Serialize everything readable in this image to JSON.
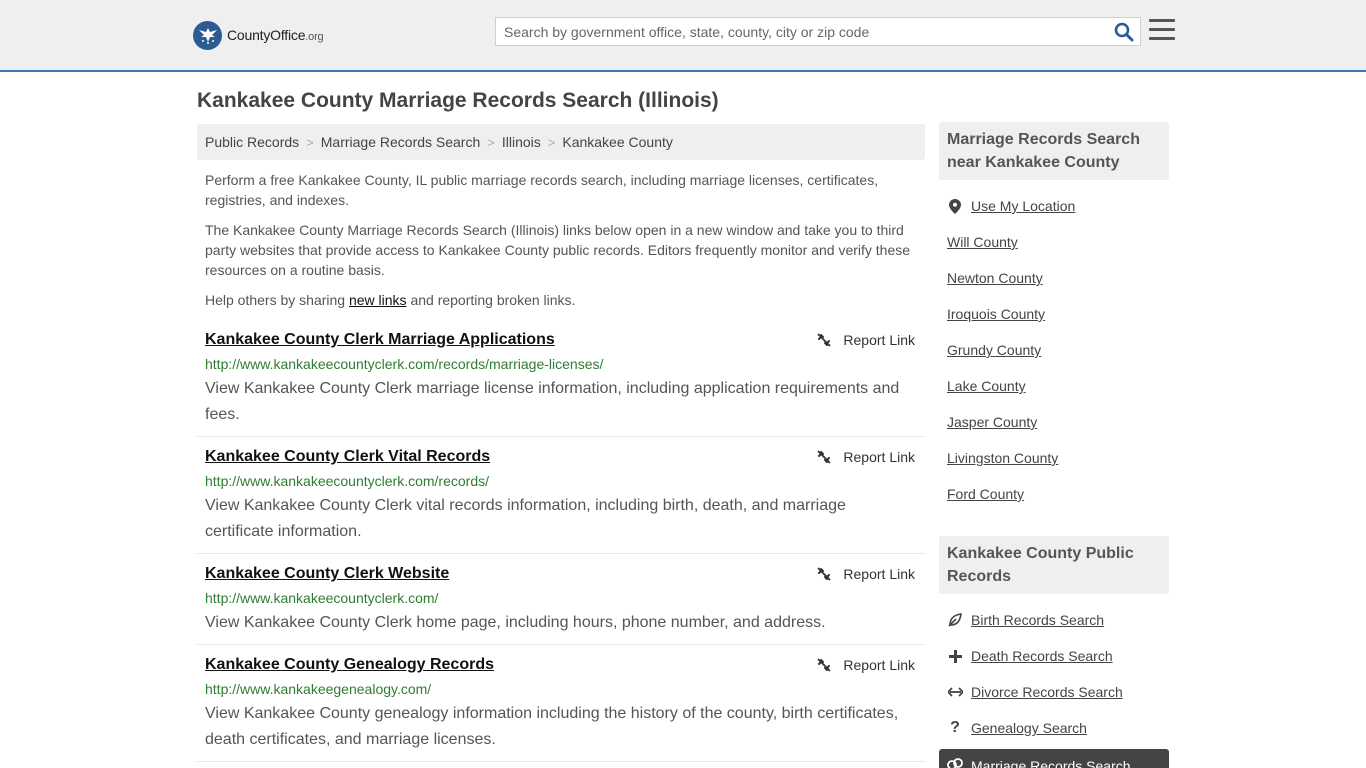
{
  "header": {
    "logo_county": "County",
    "logo_office": "Office",
    "logo_org": ".org",
    "search_placeholder": "Search by government office, state, county, city or zip code"
  },
  "page": {
    "title": "Kankakee County Marriage Records Search (Illinois)"
  },
  "breadcrumb": [
    "Public Records",
    "Marriage Records Search",
    "Illinois",
    "Kankakee County"
  ],
  "intro": {
    "p1": "Perform a free Kankakee County, IL public marriage records search, including marriage licenses, certificates, registries, and indexes.",
    "p2": "The Kankakee County Marriage Records Search (Illinois) links below open in a new window and take you to third party websites that provide access to Kankakee County public records. Editors frequently monitor and verify these resources on a routine basis.",
    "p3_before": "Help others by sharing ",
    "p3_link": "new links",
    "p3_after": " and reporting broken links."
  },
  "report_label": "Report Link",
  "results": [
    {
      "title": "Kankakee County Clerk Marriage Applications",
      "url": "http://www.kankakeecountyclerk.com/records/marriage-licenses/",
      "desc": "View Kankakee County Clerk marriage license information, including application requirements and fees."
    },
    {
      "title": "Kankakee County Clerk Vital Records",
      "url": "http://www.kankakeecountyclerk.com/records/",
      "desc": "View Kankakee County Clerk vital records information, including birth, death, and marriage certificate information."
    },
    {
      "title": "Kankakee County Clerk Website",
      "url": "http://www.kankakeecountyclerk.com/",
      "desc": "View Kankakee County Clerk home page, including hours, phone number, and address."
    },
    {
      "title": "Kankakee County Genealogy Records",
      "url": "http://www.kankakeegenealogy.com/",
      "desc": "View Kankakee County genealogy information including the history of the county, birth certificates, death certificates, and marriage licenses."
    }
  ],
  "sidebar": {
    "nearby_title": "Marriage Records Search near Kankakee County",
    "use_location": "Use My Location",
    "nearby": [
      "Will County",
      "Newton County",
      "Iroquois County",
      "Grundy County",
      "Lake County",
      "Jasper County",
      "Livingston County",
      "Ford County"
    ],
    "public_title": "Kankakee County Public Records",
    "public": [
      {
        "label": "Birth Records Search",
        "icon": "leaf-icon"
      },
      {
        "label": "Death Records Search",
        "icon": "plus-icon"
      },
      {
        "label": "Divorce Records Search",
        "icon": "arrows-icon"
      },
      {
        "label": "Genealogy Search",
        "icon": "question-icon"
      }
    ],
    "active": {
      "label": "Marriage Records Search",
      "icon": "rings-icon"
    }
  }
}
